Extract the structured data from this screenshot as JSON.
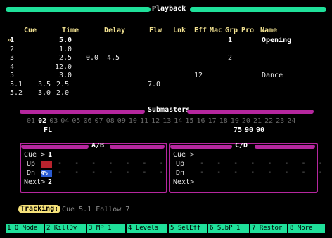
{
  "screen": {
    "title": "Playback",
    "columns": [
      "Cue",
      "Time",
      "Delay",
      "Flw",
      "Lnk",
      "Eff",
      "Mac",
      "Grp",
      "Pro",
      "Name"
    ],
    "cues": [
      {
        "cue": "1",
        "time": "5.0",
        "time2": "",
        "delay": "",
        "delay2": "",
        "flw": "",
        "lnk": "",
        "eff": "",
        "grp": "1",
        "name": "Opening",
        "active": true
      },
      {
        "cue": "2",
        "time": "1.0",
        "time2": "",
        "delay": "",
        "delay2": "",
        "flw": "",
        "lnk": "",
        "eff": "",
        "grp": "",
        "name": "",
        "active": false
      },
      {
        "cue": "3",
        "time": "2.5",
        "time2": "",
        "delay": "0.0",
        "delay2": "4.5",
        "flw": "",
        "lnk": "",
        "eff": "",
        "grp": "2",
        "name": "",
        "active": false
      },
      {
        "cue": "4",
        "time": "12.0",
        "time2": "",
        "delay": "",
        "delay2": "",
        "flw": "",
        "lnk": "",
        "eff": "",
        "grp": "",
        "name": "",
        "active": false
      },
      {
        "cue": "5",
        "time": "3.0",
        "time2": "",
        "delay": "",
        "delay2": "",
        "flw": "",
        "lnk": "",
        "eff": "12",
        "grp": "",
        "name": "Dance",
        "active": false
      },
      {
        "cue": "5.1",
        "time": "3.5",
        "time2": "2.5",
        "delay": "",
        "delay2": "",
        "flw": "7.0",
        "lnk": "",
        "eff": "",
        "grp": "",
        "name": "",
        "active": false
      },
      {
        "cue": "5.2",
        "time": "3.0",
        "time2": "2.0",
        "delay": "",
        "delay2": "",
        "flw": "",
        "lnk": "",
        "eff": "",
        "grp": "",
        "name": "",
        "active": false
      }
    ],
    "current_marker": "»"
  },
  "submasters": {
    "title": "Submasters",
    "numbers": [
      "01",
      "02",
      "03",
      "04",
      "05",
      "06",
      "07",
      "08",
      "09",
      "10",
      "11",
      "12",
      "13",
      "14",
      "15",
      "16",
      "17",
      "18",
      "19",
      "20",
      "21",
      "22",
      "23",
      "24"
    ],
    "active_number": "02",
    "fl_label": "FL",
    "levels": [
      "75",
      "90",
      "90"
    ]
  },
  "ab": {
    "title": "A/B",
    "cue_label": "Cue >",
    "cue_value": "1",
    "up_label": "Up",
    "dn_label": "Dn",
    "dn_value": "4%",
    "next_label": "Next>",
    "next_value": "2"
  },
  "cd": {
    "title": "C/D",
    "cue_label": "Cue >",
    "up_label": "Up",
    "dn_label": "Dn",
    "next_label": "Next>"
  },
  "status": {
    "tracking_label": "Tracking:",
    "text": "Cue 5.1 Follow 7"
  },
  "softkeys": [
    "1 Q Mode",
    "2 KillDv",
    "3 MP 1",
    "4 Levels",
    "5 SelEff",
    "6 SubP 1",
    "7 Restor",
    "8 More"
  ],
  "colors": {
    "accent_green": "#1fe09a",
    "panel_purple": "#b5279e",
    "header_yellow": "#f0e090",
    "tracking_yellow": "#f6e27a"
  }
}
